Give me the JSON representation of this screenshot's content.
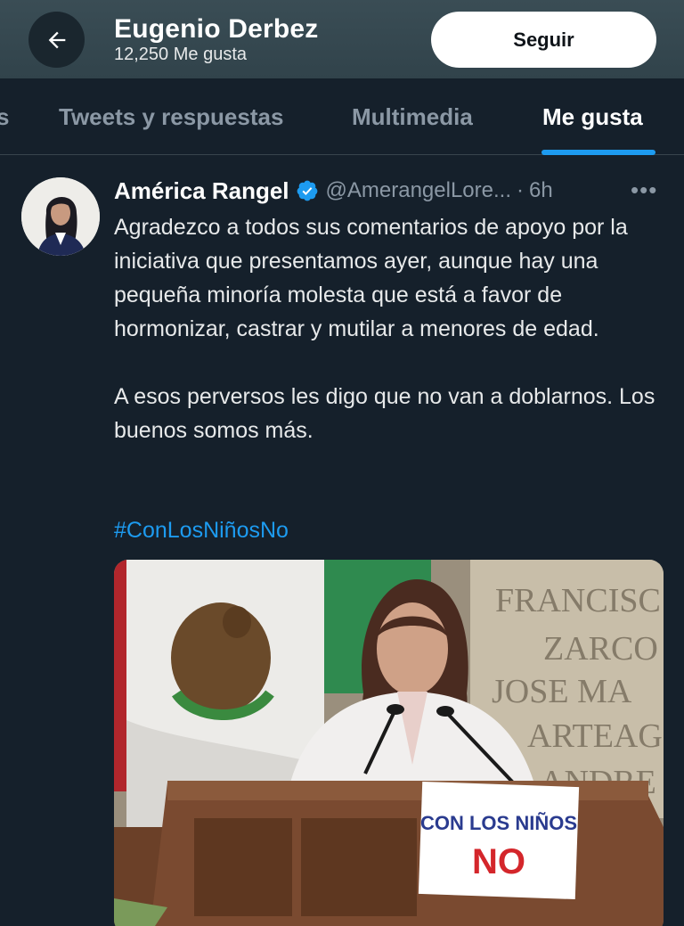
{
  "header": {
    "back_icon": "arrow-left-icon",
    "title": "Eugenio Derbez",
    "subtitle": "12,250 Me gusta",
    "follow_label": "Seguir"
  },
  "tabs": {
    "partial_label": "s",
    "items": [
      {
        "label": "Tweets y respuestas",
        "active": false
      },
      {
        "label": "Multimedia",
        "active": false
      },
      {
        "label": "Me gusta",
        "active": true
      }
    ],
    "accent_color": "#1d9bf0"
  },
  "tweet": {
    "author_name": "América Rangel",
    "verified_icon": "verified-badge-icon",
    "handle": "@AmerangelLore...",
    "separator": "·",
    "time": "6h",
    "more_icon": "more-dots-icon",
    "more_label": "•••",
    "paragraphs": [
      "Agradezco a todos sus comentarios de apoyo por la iniciativa que presentamos ayer, aunque hay una pequeña minoría molesta que está a favor de hormonizar, castrar y mutilar a menores de edad.",
      "A esos perversos les digo que no van a doblarnos. Los buenos somos más."
    ],
    "hashtag": "#ConLosNiñosNo",
    "media": {
      "wall_text": [
        "FRANCISC",
        "ZARCO",
        "JOSE MA",
        "ARTEAG",
        "ANDRE"
      ],
      "sign_line1": "CON LOS NIÑOS",
      "sign_line2": "NO",
      "sign_line1_color": "#2a3b8f",
      "sign_line2_color": "#d4262b"
    }
  }
}
